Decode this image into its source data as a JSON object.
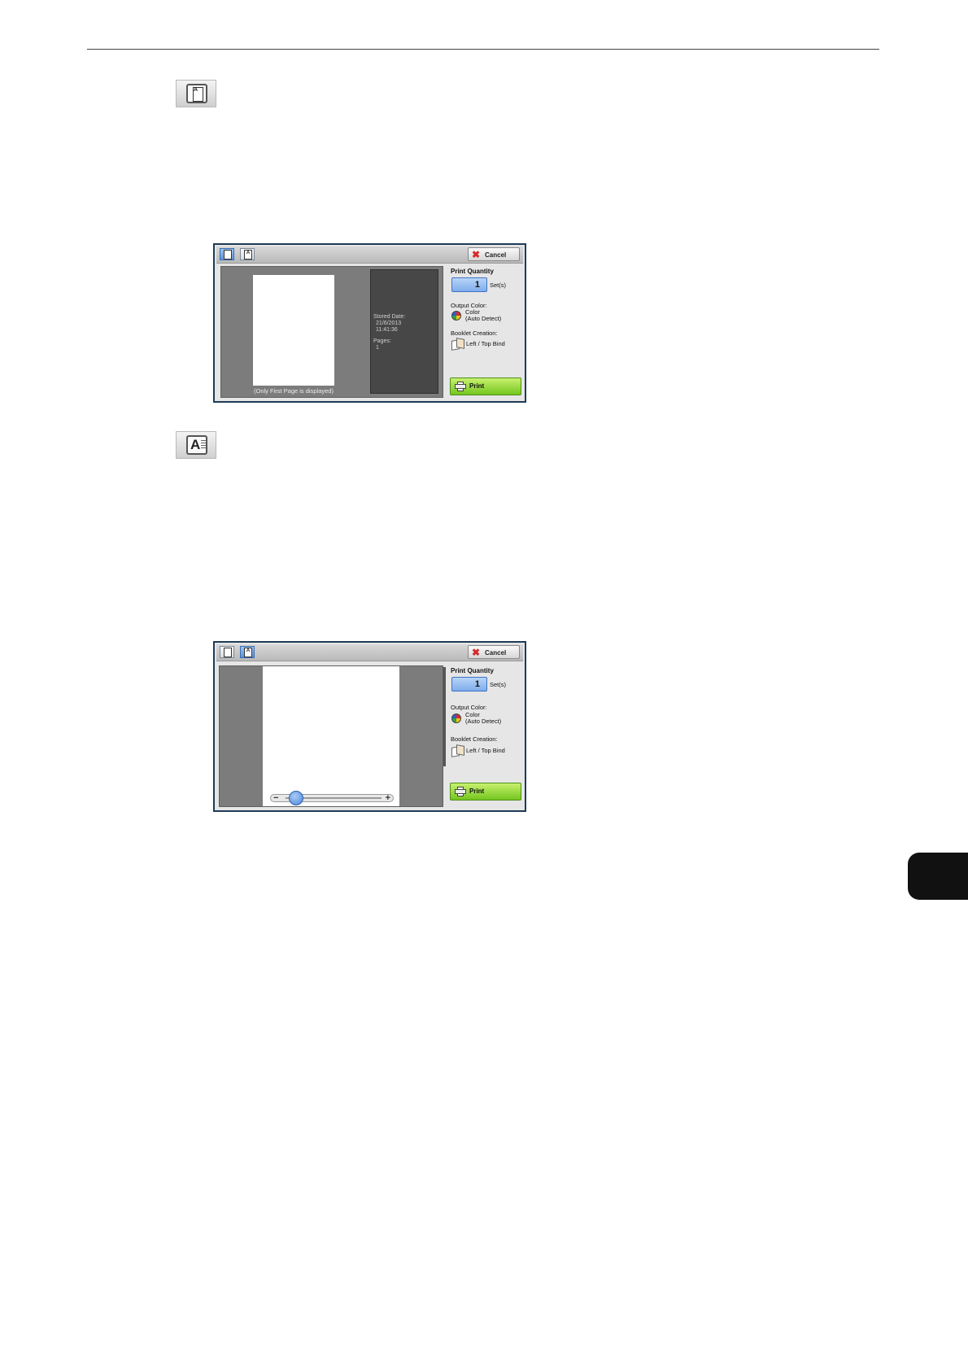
{
  "panel_1": {
    "cancel_label": "Cancel",
    "print_quantity_label": "Print Quantity",
    "quantity_value": "1",
    "sets_unit": "Set(s)",
    "output_color_label": "Output Color:",
    "output_color_value_1": "Color",
    "output_color_value_2": "(Auto Detect)",
    "booklet_label": "Booklet Creation:",
    "booklet_value": "Left / Top Bind",
    "print_label": "Print",
    "stored_date_label": "Stored Date:",
    "stored_date_value": "21/6/2013",
    "stored_time_value": "11:41:36",
    "pages_label": "Pages:",
    "pages_value": "1",
    "only_first_page_note": "(Only First Page is displayed)",
    "tab_icon_letter": "A"
  },
  "panel_2": {
    "cancel_label": "Cancel",
    "print_quantity_label": "Print Quantity",
    "quantity_value": "1",
    "sets_unit": "Set(s)",
    "output_color_label": "Output Color:",
    "output_color_value_1": "Color",
    "output_color_value_2": "(Auto Detect)",
    "booklet_label": "Booklet Creation:",
    "booklet_value": "Left / Top Bind",
    "print_label": "Print",
    "zoom_minus": "−",
    "zoom_plus": "+",
    "zoom_level_fraction": 0.07,
    "tab_icon_letter": "A"
  },
  "icons": {
    "small_view_icon_letter": "A",
    "enlarged_view_icon_letter": "A"
  },
  "colors": {
    "print_button": "#73c61e",
    "cancel_x": "#d42a2a",
    "active_tab": "#5e92d8",
    "side_tab": "#111111"
  }
}
